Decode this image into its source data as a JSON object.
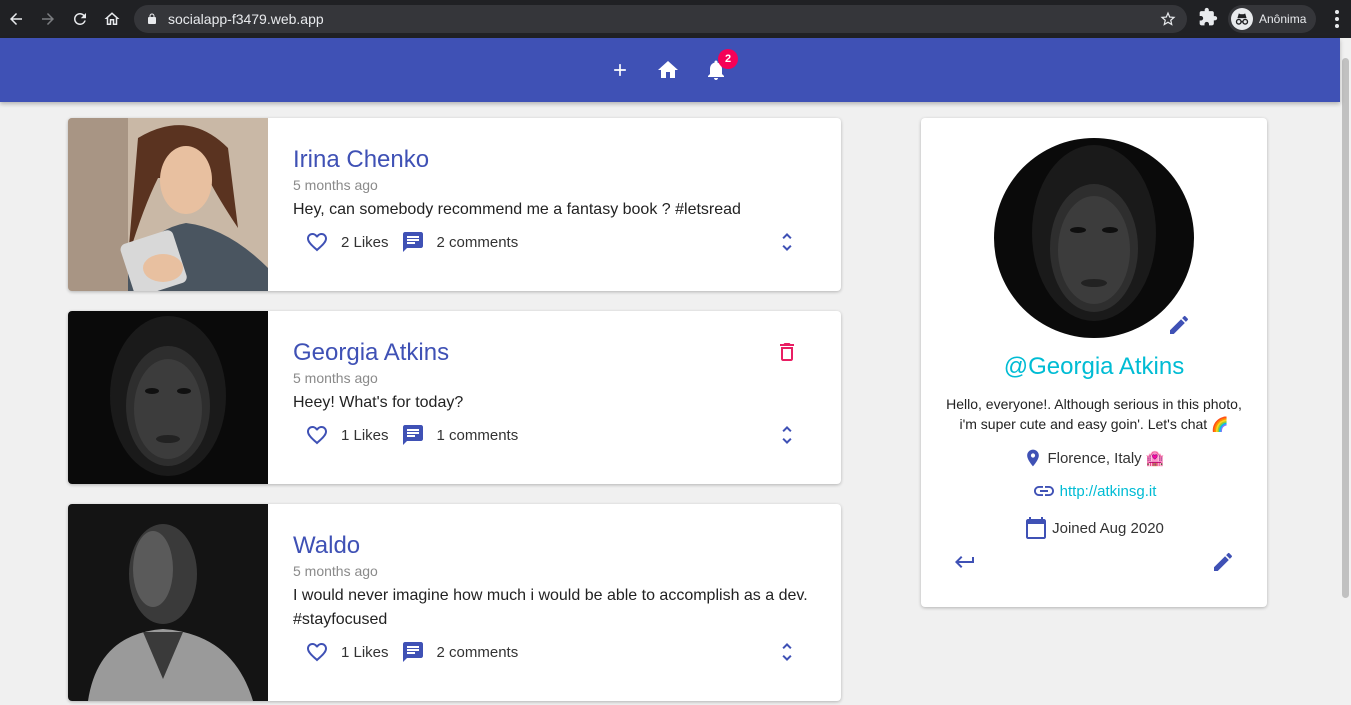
{
  "browser": {
    "url": "socialapp-f3479.web.app",
    "profile_label": "Anônima"
  },
  "appbar": {
    "notification_count": "2"
  },
  "posts": [
    {
      "name": "Irina Chenko",
      "time": "5 months ago",
      "body": "Hey, can somebody recommend me a fantasy book ? #letsread",
      "likes": "2 Likes",
      "comments": "2 comments"
    },
    {
      "name": "Georgia Atkins",
      "time": "5 months ago",
      "body": "Heey! What's for today?",
      "likes": "1 Likes",
      "comments": "1 comments"
    },
    {
      "name": "Waldo",
      "time": "5 months ago",
      "body": "I would never imagine how much i would be able to accomplish as a dev. #stayfocused",
      "likes": "1 Likes",
      "comments": "2 comments"
    }
  ],
  "profile": {
    "handle": "@Georgia Atkins",
    "bio": "Hello, everyone!. Although serious in this photo, i'm super cute and easy goin'. Let's chat 🌈",
    "location": "Florence, Italy 🏩",
    "website": "http://atkinsg.it",
    "joined": "Joined Aug 2020"
  },
  "colors": {
    "primary": "#3f51b5",
    "accent": "#00bcd4",
    "badge": "#f50057",
    "delete": "#e91e63"
  }
}
